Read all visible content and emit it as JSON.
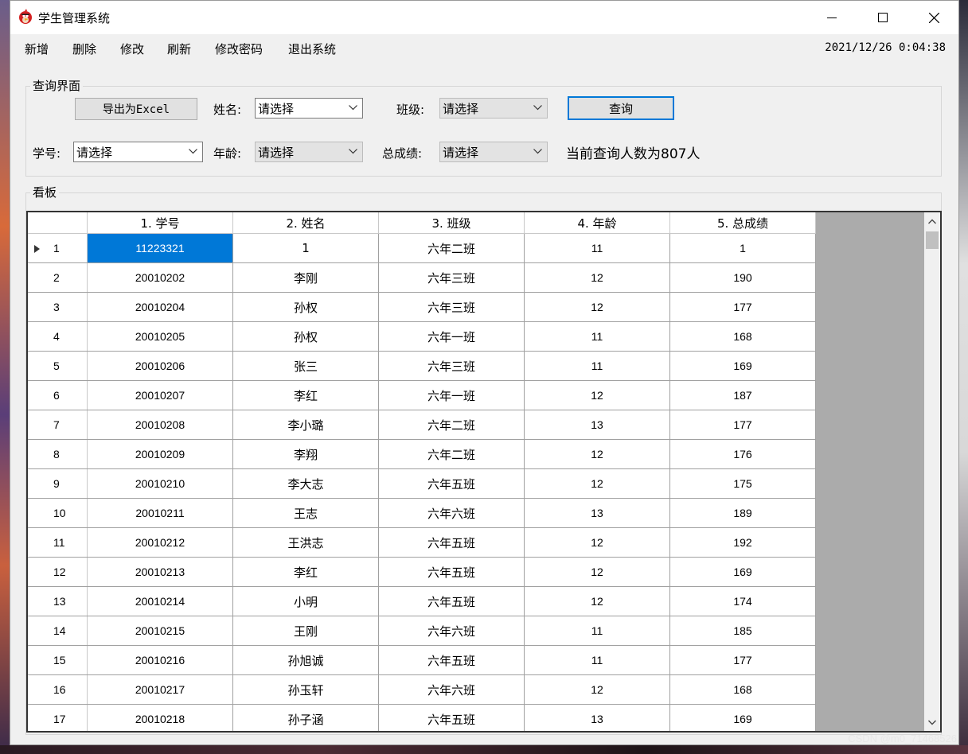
{
  "window": {
    "title": "学生管理系统"
  },
  "menu": {
    "items": [
      "新增",
      "删除",
      "修改",
      "刷新",
      "修改密码",
      "退出系统"
    ],
    "clock": "2021/12/26 0:04:38"
  },
  "query": {
    "group_label": "查询界面",
    "export_button": "导出为Excel",
    "name_label": "姓名:",
    "name_value": "请选择",
    "class_label": "班级:",
    "class_value": "请选择",
    "query_button": "查询",
    "id_label": "学号:",
    "id_value": "请选择",
    "age_label": "年龄:",
    "age_value": "请选择",
    "score_label": "总成绩:",
    "score_value": "请选择",
    "count_text": "当前查询人数为807人"
  },
  "board": {
    "group_label": "看板",
    "columns": [
      "1. 学号",
      "2. 姓名",
      "3. 班级",
      "4. 年龄",
      "5. 总成绩"
    ],
    "rows": [
      [
        "1",
        "11223321",
        "1",
        "六年二班",
        "11",
        "1"
      ],
      [
        "2",
        "20010202",
        "李刚",
        "六年三班",
        "12",
        "190"
      ],
      [
        "3",
        "20010204",
        "孙权",
        "六年三班",
        "12",
        "177"
      ],
      [
        "4",
        "20010205",
        "孙权",
        "六年一班",
        "11",
        "168"
      ],
      [
        "5",
        "20010206",
        "张三",
        "六年三班",
        "11",
        "169"
      ],
      [
        "6",
        "20010207",
        "李红",
        "六年一班",
        "12",
        "187"
      ],
      [
        "7",
        "20010208",
        "李小璐",
        "六年二班",
        "13",
        "177"
      ],
      [
        "8",
        "20010209",
        "李翔",
        "六年二班",
        "12",
        "176"
      ],
      [
        "9",
        "20010210",
        "李大志",
        "六年五班",
        "12",
        "175"
      ],
      [
        "10",
        "20010211",
        "王志",
        "六年六班",
        "13",
        "189"
      ],
      [
        "11",
        "20010212",
        "王洪志",
        "六年五班",
        "12",
        "192"
      ],
      [
        "12",
        "20010213",
        "李红",
        "六年五班",
        "12",
        "169"
      ],
      [
        "13",
        "20010214",
        "小明",
        "六年五班",
        "12",
        "174"
      ],
      [
        "14",
        "20010215",
        "王刚",
        "六年六班",
        "11",
        "185"
      ],
      [
        "15",
        "20010216",
        "孙旭诚",
        "六年五班",
        "11",
        "177"
      ],
      [
        "16",
        "20010217",
        "孙玉轩",
        "六年六班",
        "12",
        "168"
      ],
      [
        "17",
        "20010218",
        "孙子涵",
        "六年五班",
        "13",
        "169"
      ]
    ]
  },
  "watermark": "CSDN @m0_71468526",
  "colors": {
    "selection": "#0078d7",
    "grid_background": "#ababab"
  }
}
